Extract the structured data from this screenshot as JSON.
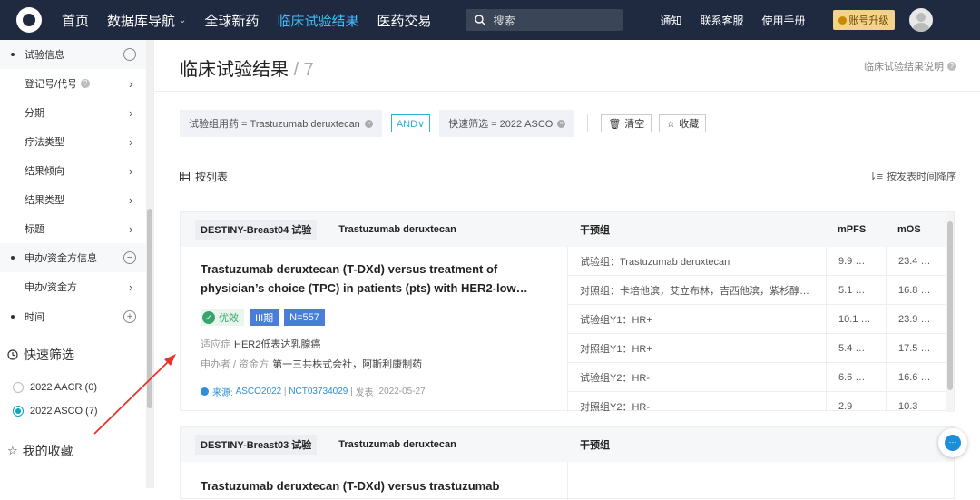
{
  "nav": {
    "items": [
      {
        "label": "首页"
      },
      {
        "label": "数据库导航"
      },
      {
        "label": "全球新药"
      },
      {
        "label": "临床试验结果"
      },
      {
        "label": "医药交易"
      }
    ],
    "search_placeholder": "搜索",
    "links": [
      "通知",
      "联系客服",
      "使用手册"
    ],
    "upgrade_label": "账号升级",
    "active_color": "#3ec0ff"
  },
  "sidebar": {
    "groups": [
      {
        "label": "试验信息",
        "toggle": "−"
      },
      {
        "label": "申办/资金方信息",
        "toggle": "−"
      },
      {
        "label": "时间",
        "toggle": "+"
      }
    ],
    "items": [
      {
        "label": "登记号/代号"
      },
      {
        "label": "分期"
      },
      {
        "label": "疗法类型"
      },
      {
        "label": "结果倾向"
      },
      {
        "label": "结果类型"
      },
      {
        "label": "标题"
      },
      {
        "label": "申办/资金方"
      }
    ],
    "quick_title": "快速筛选",
    "quick_options": [
      {
        "label": "2022 AACR",
        "count": "(0)"
      },
      {
        "label": "2022 ASCO",
        "count": "(7)"
      }
    ],
    "favorites_title": "我的收藏"
  },
  "main": {
    "title": "临床试验结果",
    "count": "/ 7",
    "help_link": "临床试验结果说明",
    "filters": {
      "chip1": "试验组用药 = Trastuzumab deruxtecan",
      "and_label": "AND∨",
      "chip2": "快速筛选 = 2022 ASCO",
      "clear_label": "清空",
      "fav_label": "收藏"
    },
    "view_label": "按列表",
    "sort_label": "按发表时间降序",
    "columns": {
      "group": "干预组",
      "mpfs": "mPFS",
      "mos": "mOS"
    },
    "cards": [
      {
        "trial": "DESTINY-Breast04 试验",
        "drug": "Trastuzumab deruxtecan",
        "title": "Trastuzumab deruxtecan (T-DXd) versus treatment of physician’s choice (TPC) in patients (pts) with HER2-low…",
        "tag_green": "优效",
        "tag_phase": "III期",
        "tag_n": "N=557",
        "indication_label": "适应症",
        "indication": "HER2低表达乳腺癌",
        "sponsor_label": "申办者 / 资金方",
        "sponsor": "第一三共株式会社，阿斯利康制药",
        "source_label": "来源:",
        "source": "ASCO2022",
        "nct": "NCT03734029",
        "pub_label": "发表",
        "pub_date": "2022-05-27",
        "rows": [
          {
            "group": "试验组：Trastuzumab deruxtecan",
            "mpfs": "9.9 …",
            "mos": "23.4 …"
          },
          {
            "group": "对照组：卡培他滨，艾立布林，吉西他滨，紫杉醇…",
            "mpfs": "5.1 …",
            "mos": "16.8 …"
          },
          {
            "group": "试验组Y1：HR+",
            "mpfs": "10.1 …",
            "mos": "23.9 …"
          },
          {
            "group": "对照组Y1：HR+",
            "mpfs": "5.4 …",
            "mos": "17.5 …"
          },
          {
            "group": "试验组Y2：HR-",
            "mpfs": "6.6 …",
            "mos": "16.6 …"
          },
          {
            "group": "对照组Y2：HR-",
            "mpfs": "2.9",
            "mos": "10.3"
          }
        ]
      },
      {
        "trial": "DESTINY-Breast03 试验",
        "drug": "Trastuzumab deruxtecan",
        "title": "Trastuzumab deruxtecan (T-DXd) versus trastuzumab"
      }
    ]
  }
}
